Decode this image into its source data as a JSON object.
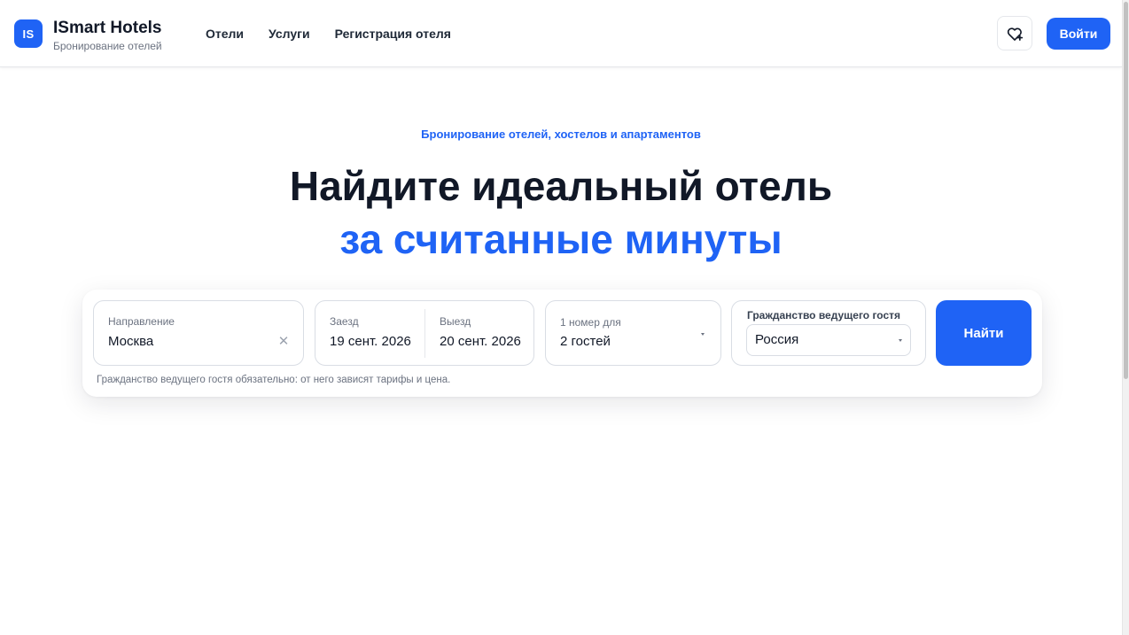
{
  "header": {
    "logo_text": "IS",
    "brand_title": "ISmart Hotels",
    "brand_subtitle": "Бронирование отелей",
    "nav": [
      {
        "label": "Отели"
      },
      {
        "label": "Услуги"
      },
      {
        "label": "Регистрация отеля"
      }
    ],
    "favorites_icon": "heart-plus-icon",
    "login_label": "Войти"
  },
  "hero": {
    "kicker": "Бронирование отелей, хостелов и апартаментов",
    "title_line1": "Найдите идеальный отель",
    "title_line2": "за считанные минуты"
  },
  "search": {
    "destination": {
      "label": "Направление",
      "value": "Москва",
      "clear_icon": "close-icon"
    },
    "checkin": {
      "label": "Заезд",
      "value": "19 сент. 2026"
    },
    "checkout": {
      "label": "Выезд",
      "value": "20 сент. 2026"
    },
    "guests": {
      "label": "1 номер для",
      "value": "2 гостей"
    },
    "citizenship": {
      "label": "Гражданство ведущего гостя",
      "value": "Россия"
    },
    "submit_label": "Найти",
    "hint": "Гражданство ведущего гостя обязательно: от него зависят тарифы и цена."
  },
  "colors": {
    "accent": "#1f63f5",
    "text": "#111827",
    "muted": "#6b7280",
    "border": "#d9dde4"
  }
}
